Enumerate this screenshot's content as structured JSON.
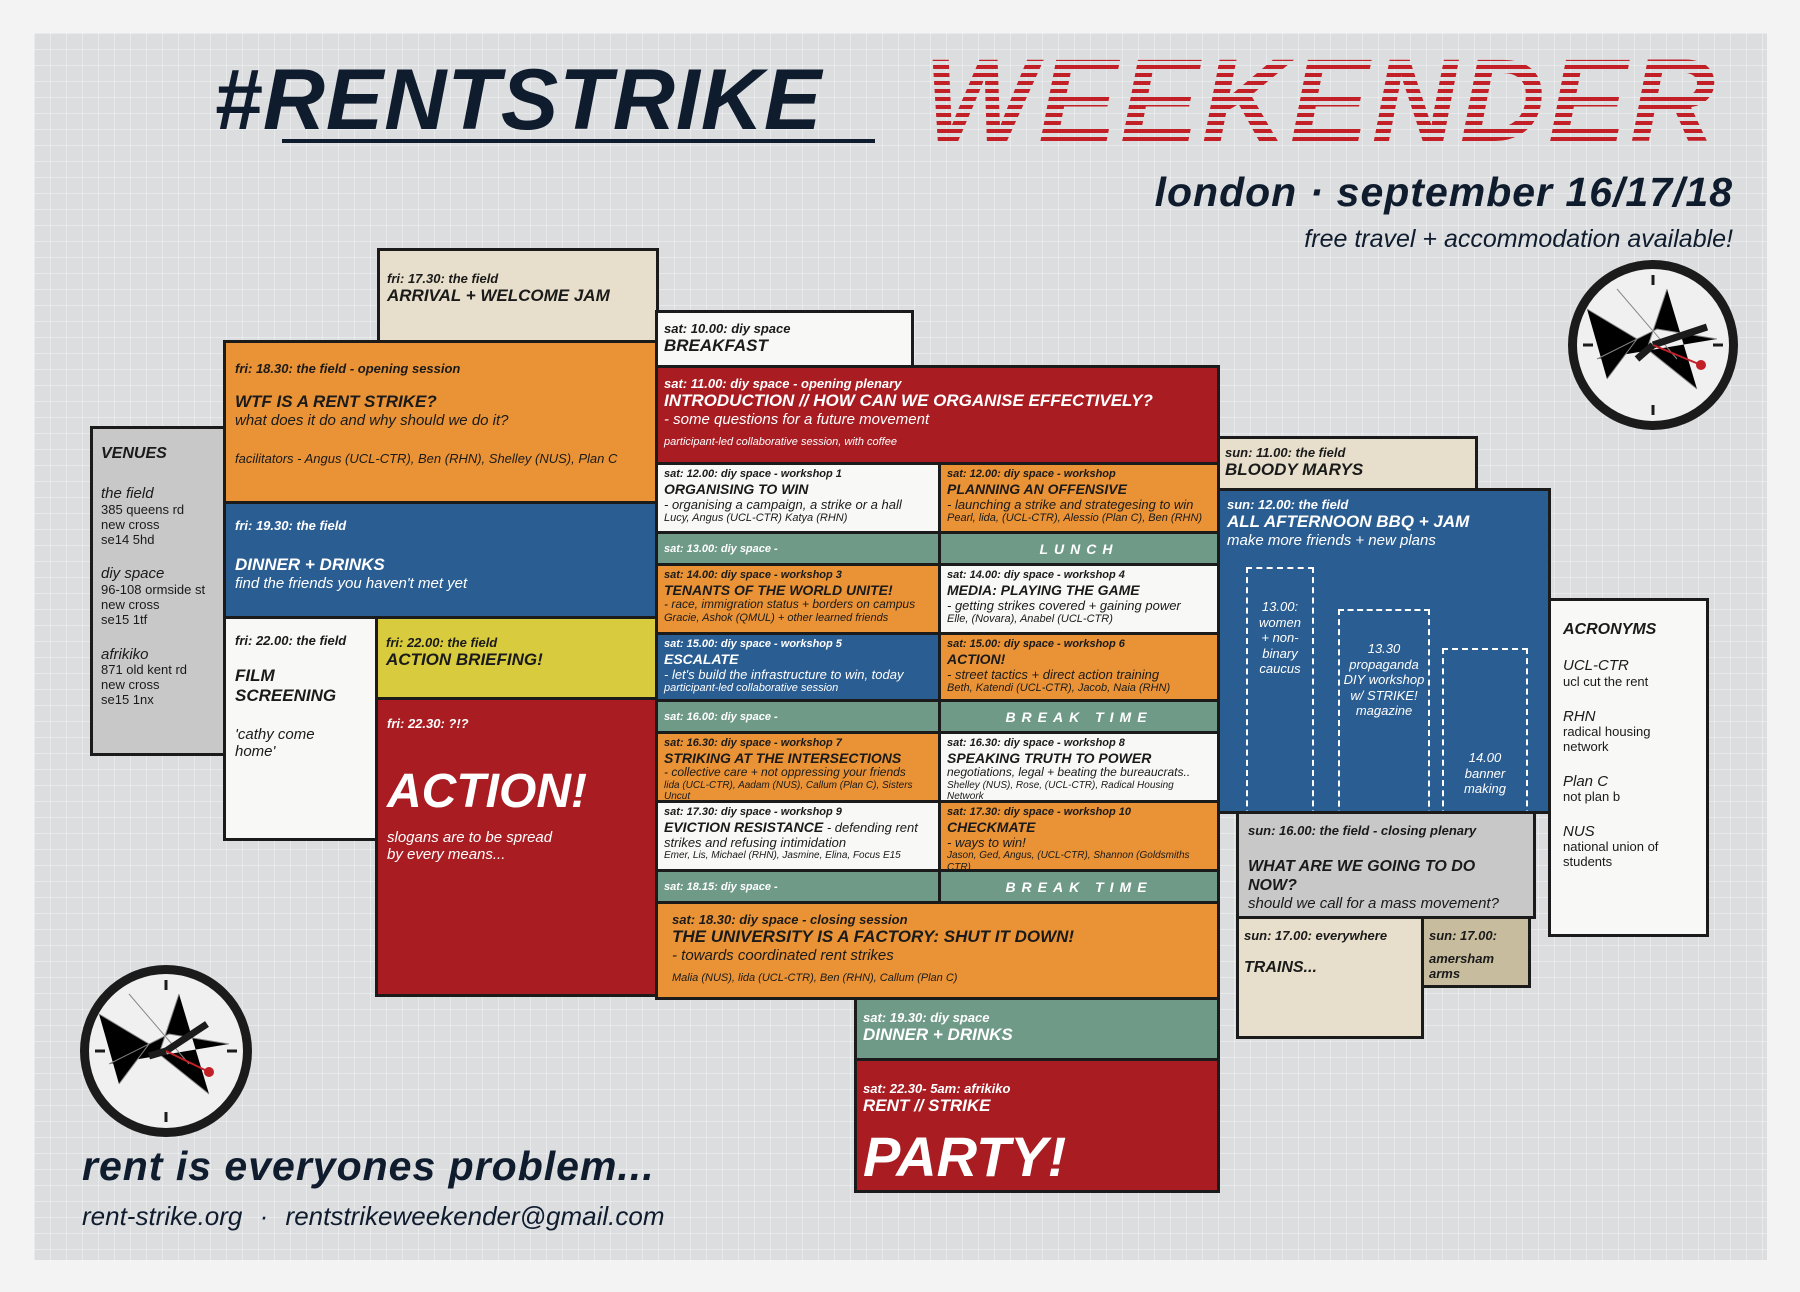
{
  "header": {
    "title": "#RENTSTRIKE",
    "subtitle": "WEEKENDER",
    "date": "london · september 16/17/18",
    "tagline": "free travel + accommodation available!"
  },
  "footer": {
    "slogan": "rent is everyones problem...",
    "website": "rent-strike.org",
    "separator": "·",
    "email": "rentstrikeweekender@gmail.com"
  },
  "venues": {
    "heading": "VENUES",
    "list": [
      {
        "name": "the field",
        "lines": [
          "385 queens rd",
          "new cross",
          "se14 5hd"
        ]
      },
      {
        "name": "diy space",
        "lines": [
          "96-108 ormside st",
          "new cross",
          "se15 1tf"
        ]
      },
      {
        "name": "afrikiko",
        "lines": [
          "871 old kent rd",
          "new cross",
          "se15 1nx"
        ]
      }
    ]
  },
  "acronyms": {
    "heading": "ACRONYMS",
    "list": [
      {
        "abbr": "UCL-CTR",
        "full": "ucl cut the rent"
      },
      {
        "abbr": "RHN",
        "full": "radical housing network"
      },
      {
        "abbr": "Plan C",
        "full": "not plan b"
      },
      {
        "abbr": "NUS",
        "full": "national union of students"
      }
    ]
  },
  "fri": {
    "arrival": {
      "time": "fri: 17.30: the field",
      "title": "ARRIVAL + WELCOME JAM"
    },
    "opening": {
      "time": "fri: 18.30: the field  - opening session",
      "title": "WTF IS A RENT STRIKE?",
      "desc": "what does it do and why should we do it?",
      "people": "facilitators - Angus (UCL-CTR), Ben (RHN), Shelley (NUS), Plan C"
    },
    "dinner": {
      "time": "fri: 19.30: the field",
      "title": "DINNER + DRINKS",
      "desc": "find the friends you haven't met yet"
    },
    "film": {
      "time": "fri: 22.00: the field",
      "title1": "FILM",
      "title2": "SCREENING",
      "desc1": "'cathy come",
      "desc2": "home'"
    },
    "briefing": {
      "time": "fri: 22.00: the field",
      "title": "ACTION BRIEFING!"
    },
    "action": {
      "time": "fri: 22.30: ?!?",
      "title": "ACTION!",
      "desc1": "slogans are to be spread",
      "desc2": "by  every means..."
    }
  },
  "sat": {
    "breakfast": {
      "time": "sat: 10.00: diy space",
      "title": "BREAKFAST"
    },
    "plenary": {
      "time": "sat: 11.00: diy space  - opening plenary",
      "title": "INTRODUCTION // HOW CAN WE ORGANISE EFFECTIVELY?",
      "desc": "- some questions for a future movement",
      "note": "participant-led collaborative session, with coffee"
    },
    "w1": {
      "time": "sat: 12.00: diy space  - workshop 1",
      "title": "ORGANISING TO WIN",
      "desc": "- organising a campaign, a strike or a hall",
      "people": "Lucy, Angus (UCL-CTR) Katya (RHN)"
    },
    "w2": {
      "time": "sat: 12.00: diy space  - workshop",
      "title": "PLANNING AN OFFENSIVE",
      "desc": "- launching a strike and strategesing to win",
      "people": "Pearl, lida, (UCL-CTR), Alessio (Plan C), Ben (RHN)"
    },
    "b1300": {
      "time": "sat: 13.00: diy space -"
    },
    "lunch": {
      "label": "LUNCH"
    },
    "w3": {
      "time": "sat: 14.00: diy space  - workshop 3",
      "title": "TENANTS OF THE WORLD UNITE!",
      "desc": "- race, immigration status + borders on campus",
      "people": "Gracie, Ashok (QMUL) + other learned friends"
    },
    "w4": {
      "time": "sat: 14.00: diy space  - workshop 4",
      "title": "MEDIA: PLAYING THE GAME",
      "desc": "- getting strikes covered + gaining power",
      "people": "Elle, (Novara), Anabel (UCL-CTR)"
    },
    "w5": {
      "time": "sat: 15.00: diy space  - workshop 5",
      "title": "ESCALATE",
      "desc": "- let's build the infrastructure to win, today",
      "people": "participant-led collaborative session"
    },
    "w6": {
      "time": "sat: 15.00: diy space  - workshop 6",
      "title": "ACTION!",
      "desc": "- street tactics + direct action training",
      "people": "Beth, Katendi (UCL-CTR), Jacob, Naia (RHN)"
    },
    "b1600": {
      "time": "sat: 16.00: diy space -"
    },
    "break1": {
      "label": "BREAK TIME"
    },
    "w7": {
      "time": "sat: 16.30: diy space  - workshop 7",
      "title": "STRIKING AT THE INTERSECTIONS",
      "desc": "- collective care + not oppressing your friends",
      "people": "lida (UCL-CTR), Aadam (NUS), Callum (Plan C), Sisters Uncut"
    },
    "w8": {
      "time": "sat: 16.30: diy space  - workshop 8",
      "title": "SPEAKING TRUTH TO POWER",
      "desc": "negotiations, legal + beating the bureaucrats..",
      "people": "Shelley (NUS), Rose, (UCL-CTR), Radical Housing Network"
    },
    "w9": {
      "time": "sat: 17.30: diy space  - workshop 9",
      "title": "EVICTION RESISTANCE",
      "desc": " - defending rent",
      "desc2": "strikes and refusing intimidation",
      "people": "Emer, Lis, Michael (RHN), Jasmine,  Elina, Focus E15"
    },
    "w10": {
      "time": "sat: 17.30: diy space  - workshop 10",
      "title": "CHECKMATE",
      "desc": "- ways to win!",
      "people": "Jason, Ged,  Angus, (UCL-CTR), Shannon (Goldsmiths CTR)"
    },
    "b1815": {
      "time": "sat: 18.15: diy space -"
    },
    "break2": {
      "label": "BREAK TIME"
    },
    "closing": {
      "time": "sat: 18.30: diy space  - closing session",
      "title": "THE UNIVERSITY IS A FACTORY: SHUT IT DOWN!",
      "desc": "- towards coordinated rent strikes",
      "people": "Malia (NUS), lida (UCL-CTR), Ben (RHN), Callum (Plan C)"
    },
    "dinner": {
      "time": "sat: 19.30: diy space",
      "title": "DINNER + DRINKS"
    },
    "party": {
      "time": "sat: 22.30- 5am: afrikiko",
      "title": "RENT // STRIKE",
      "big": "PARTY!"
    }
  },
  "sun": {
    "marys": {
      "time": "sun: 11.00: the field",
      "title": "BLOODY MARYS"
    },
    "bbq": {
      "time": "sun: 12.00: the field",
      "title": "ALL AFTERNOON BBQ + JAM",
      "desc": "make more friends + new plans",
      "sub": [
        {
          "l1": "13.00:",
          "l2": "women",
          "l3": "+ non-",
          "l4": "binary",
          "l5": "caucus"
        },
        {
          "l1": "13.30",
          "l2": "propaganda",
          "l3": "DIY workshop",
          "l4": "w/ STRIKE!",
          "l5": "magazine"
        },
        {
          "l1": "14.00",
          "l2": "banner",
          "l3": "making"
        }
      ]
    },
    "plenary": {
      "time": "sun: 16.00: the field  - closing plenary",
      "title": "WHAT ARE WE GOING TO DO NOW?",
      "desc": "should we call for a mass movement?"
    },
    "trains": {
      "time": "sun: 17.00: everywhere",
      "title": "TRAINS..."
    },
    "amersham": {
      "time": "sun: 17.00:",
      "title": "amersham arms"
    }
  }
}
